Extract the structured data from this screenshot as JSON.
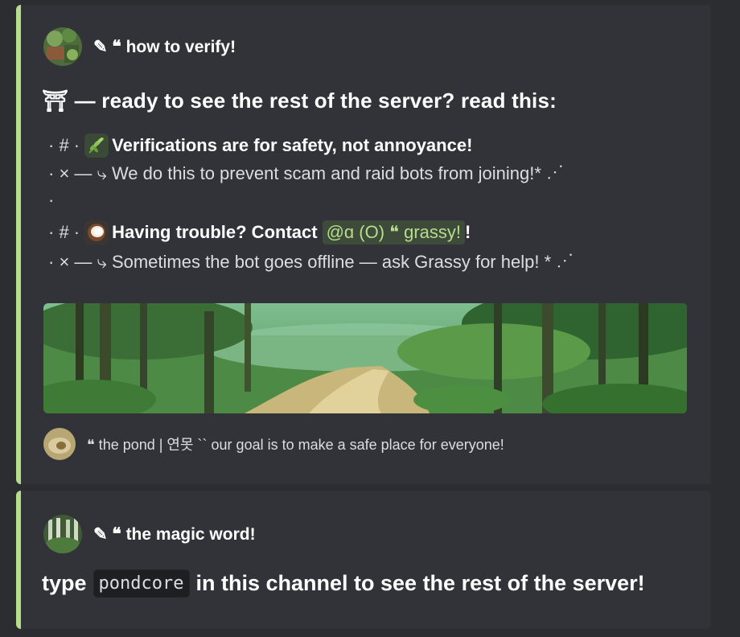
{
  "embeds": [
    {
      "author": "✎ ❝ how to verify!",
      "title": "⛩ — ready to see the rest of the server? read this:",
      "lines": {
        "l1_prefix": "· # ·",
        "l1_text": "Verifications are for safety, not annoyance!",
        "l2": "· × — ⤷ We do this to prevent scam and raid bots from joining!* ⋰",
        "l3": "·",
        "l4_prefix": "· # ·",
        "l4_text": "Having trouble? Contact",
        "l4_mention": "@ɑ (O) ❝ grassy!",
        "l4_suffix": "!",
        "l5": "· × — ⤷ Sometimes the bot goes offline — ask Grassy for help! * ⋰"
      },
      "footer": "❝ the pond | 연못 `` our goal is to make a safe place for everyone!"
    },
    {
      "author": "✎ ❝ the magic word!",
      "body_before": "type",
      "code": "pondcore",
      "body_after": "in this channel to see the rest of the server!"
    }
  ],
  "colors": {
    "accent": "#b5dd8c",
    "background": "#2b2d31",
    "embed_bg": "#313338",
    "mention_text": "#b5dd8c"
  },
  "icons": {
    "leaf_emoji": "herb-emoji-icon",
    "coconut_emoji": "coconut-emoji-icon"
  }
}
